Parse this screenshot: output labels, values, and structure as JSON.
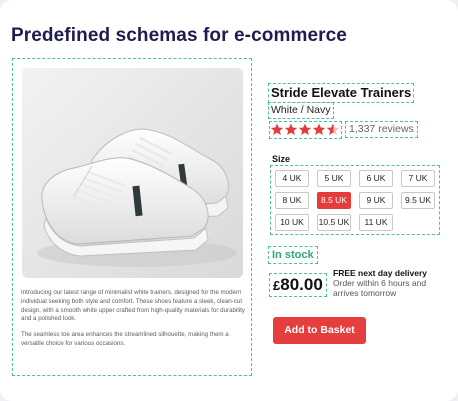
{
  "page": {
    "title": "Predefined schemas for e-commerce"
  },
  "product": {
    "name": "Stride Elevate Trainers",
    "variant": "White / Navy",
    "rating": 4.5,
    "rating_max": 5,
    "reviews": "1,337 reviews",
    "description": [
      "Introducing our latest range of minimalist white trainers, designed for the modern individual seeking both style and comfort. These shoes feature a sleek, clean-cut design, with a smooth white upper crafted from high-quality materials for durability and a polished look.",
      "The seamless toe area enhances the streamlined silhouette, making them a versatile choice for various occasions."
    ],
    "size_label": "Size",
    "sizes": [
      "4 UK",
      "5 UK",
      "6 UK",
      "7 UK",
      "8 UK",
      "8.5 UK",
      "9 UK",
      "9.5 UK",
      "10 UK",
      "10.5 UK",
      "11 UK"
    ],
    "selected_size": "8.5 UK",
    "stock": "In stock",
    "price_currency": "£",
    "price_amount": "80.00",
    "delivery_title": "FREE next day delivery",
    "delivery_text": "Order within 6 hours and arrives tomorrow",
    "cta_label": "Add to Basket"
  },
  "colors": {
    "accent": "#e43e3e",
    "stock": "#2fa57e",
    "title": "#1f1d4e",
    "outline": "#4cc29a"
  }
}
